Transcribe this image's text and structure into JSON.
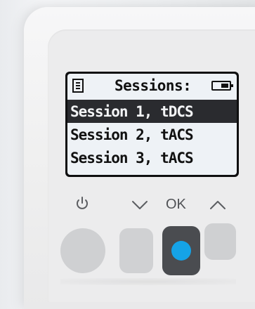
{
  "colors": {
    "accent": "#15a3e7",
    "lcd_bg": "#eef2f6",
    "selected_bg": "#2a2b2f"
  },
  "screen": {
    "header": {
      "title": "Sessions:",
      "icon": "menu-icon",
      "battery_icon": "battery-icon",
      "battery_level": 0.5
    },
    "items": [
      {
        "label": "Session 1, tDCS",
        "selected": true
      },
      {
        "label": "Session 2, tACS",
        "selected": false
      },
      {
        "label": "Session 3, tACS",
        "selected": false
      }
    ]
  },
  "controls": {
    "labels": {
      "power_icon": "power-icon",
      "down_icon": "chevron-down-icon",
      "ok": "OK",
      "up_icon": "chevron-up-icon"
    }
  }
}
